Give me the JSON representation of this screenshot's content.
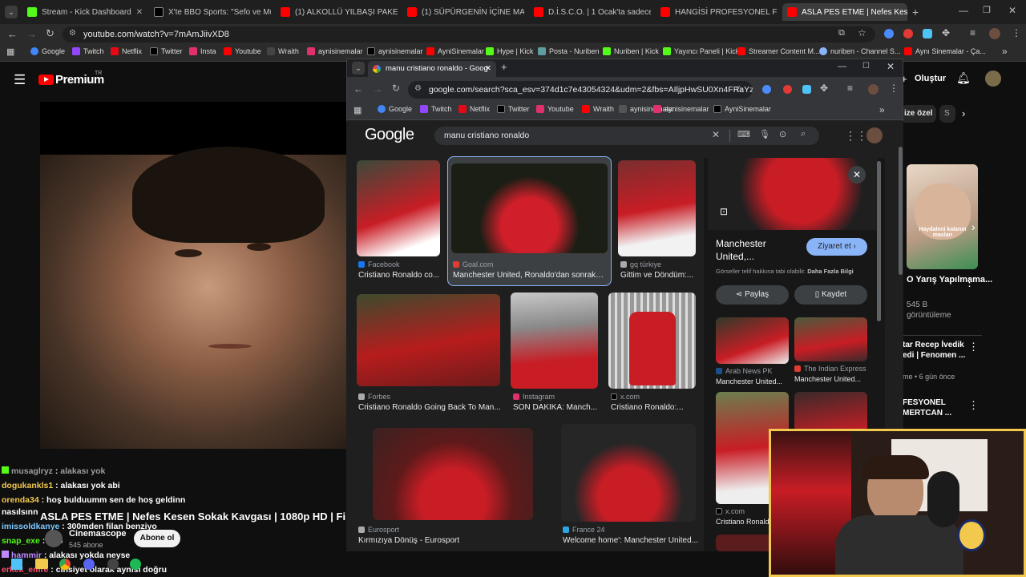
{
  "outer_tabs": [
    {
      "label": "Stream - Kick Dashboard",
      "color": "#53fc18"
    },
    {
      "label": "X'te BBO Sports: \"Sefo ve Must",
      "color": "#ffffff"
    },
    {
      "label": "(1) ALKOLLÜ YILBAŞI PAKETLER",
      "color": "#ff0000"
    },
    {
      "label": "(1) SÜPÜRGENİN İÇİNE MAYTAP",
      "color": "#ff0000"
    },
    {
      "label": "D.İ.S.C.O. | 1 Ocak'ta sadece sin",
      "color": "#ff0000"
    },
    {
      "label": "HANGİSİ PROFESYONEL FUTBOL",
      "color": "#ff0000"
    },
    {
      "label": "ASLA PES ETME | Nefes Kesen S",
      "color": "#ff0000"
    }
  ],
  "outer_url": "youtube.com/watch?v=7mAmJiivXD8",
  "bookmarks": [
    "Google",
    "Twitch",
    "Netflix",
    "Twitter",
    "Insta",
    "Youtube",
    "Wraith",
    "aynisinemalar",
    "aynisinemalar",
    "AyniSinemalar",
    "Hype | Kick",
    "Posta - Nuriben",
    "Nuriben | Kick",
    "Yayıncı Paneli | Kick",
    "Streamer Content M...",
    "nuriben - Channel S...",
    "Aynı Sinemalar - Ça..."
  ],
  "yt": {
    "premium": "Premium",
    "tr": "TR",
    "create": "Oluştur",
    "chip": "ize özel",
    "chip2": "S",
    "video_title": "ASLA PES ETME | Nefes Kesen Sokak Kavgası | 1080p HD | Film",
    "channel": "Cinemascope",
    "subs": "545 abone",
    "subscribe": "Abone ol",
    "side1_title": "O Yarış Yapılmama...",
    "side1_meta1": "545 B",
    "side1_meta2": "görüntüleme",
    "side2_title": "tar Recep İvedik",
    "side2_title2": "edi | Fenomen ...",
    "side2_meta": "me • 6 gün önce",
    "side3_title": "FESYONEL",
    "side3_title2": "MERTCAN ...",
    "thumb_text": "Haydaleni kalanın\nmasları"
  },
  "chat": [
    {
      "user": "musaglryz",
      "msg": "alakası yok",
      "color": "#9e9e9e"
    },
    {
      "user": "dogukankls1",
      "msg": "alakası yok abi",
      "color": "#f2c94c"
    },
    {
      "user": "orenda34",
      "msg": "hoş bulduumm sen de hoş geldinn",
      "color": "#f2c94c"
    },
    {
      "user": "",
      "msg": "nasılsınn",
      "color": "#ffffff"
    },
    {
      "user": "imissoldkanye",
      "msg": "300mden filan benziyo",
      "color": "#7ec8ff"
    },
    {
      "user": "snap_exe",
      "msg": "hbb",
      "color": "#53fc18"
    },
    {
      "user": "hammir",
      "msg": "alakası yokda neyse",
      "color": "#c08aff"
    },
    {
      "user": "erkek_emre",
      "msg": "cinsiyet olarak aynısı doğru",
      "color": "#ff4d6d"
    }
  ],
  "inner": {
    "tab_title": "manu cristiano ronaldo - Goog",
    "url": "google.com/search?sca_esv=374d1c7e43054324&udm=2&fbs=AIljpHwSU0Xn4FRaYzhf...",
    "bookmarks": [
      "Google",
      "Twitch",
      "Netflix",
      "Twitter",
      "Youtube",
      "Wraith",
      "aynisinemalar",
      "aynisinemalar",
      "AyniSinemalar"
    ],
    "logo": "Google",
    "query": "manu cristiano ronaldo"
  },
  "results": [
    {
      "source": "Facebook",
      "caption": "Cristiano Ronaldo co...",
      "color": "#1877f2"
    },
    {
      "source": "Goal.com",
      "caption": "Manchester United, Ronaldo'dan sonraki ...",
      "color": "#e03c31"
    },
    {
      "source": "gq türkiye",
      "caption": "Gittim ve Döndüm:...",
      "color": "#aaaaaa"
    },
    {
      "source": "Forbes",
      "caption": "Cristiano Ronaldo Going Back To Man...",
      "color": "#aaaaaa"
    },
    {
      "source": "Instagram",
      "caption": "SON DAKİKA: Manch...",
      "color": "#e1306c"
    },
    {
      "source": "x.com",
      "caption": "Cristiano Ronaldo:...",
      "color": "#aaaaaa"
    },
    {
      "source": "Eurosport",
      "caption": "Kırmızıya Dönüş - Eurosport",
      "color": "#aaaaaa"
    },
    {
      "source": "France 24",
      "caption": "Welcome home': Manchester United...",
      "color": "#2aa6e0"
    }
  ],
  "preview": {
    "title1": "Manchester",
    "title2": "United,...",
    "visit": "Ziyaret et",
    "copyright": "Görseller telif hakkına tabi olabilir.",
    "more": "Daha Fazla Bilgi",
    "share": "Paylaş",
    "save": "Kaydet",
    "related": [
      {
        "source": "Arab News PK",
        "caption": "Manchester United..."
      },
      {
        "source": "The Indian Express",
        "caption": "Manchester United..."
      },
      {
        "source": "x.com",
        "caption": "Cristiano Ronaldo..."
      }
    ]
  }
}
